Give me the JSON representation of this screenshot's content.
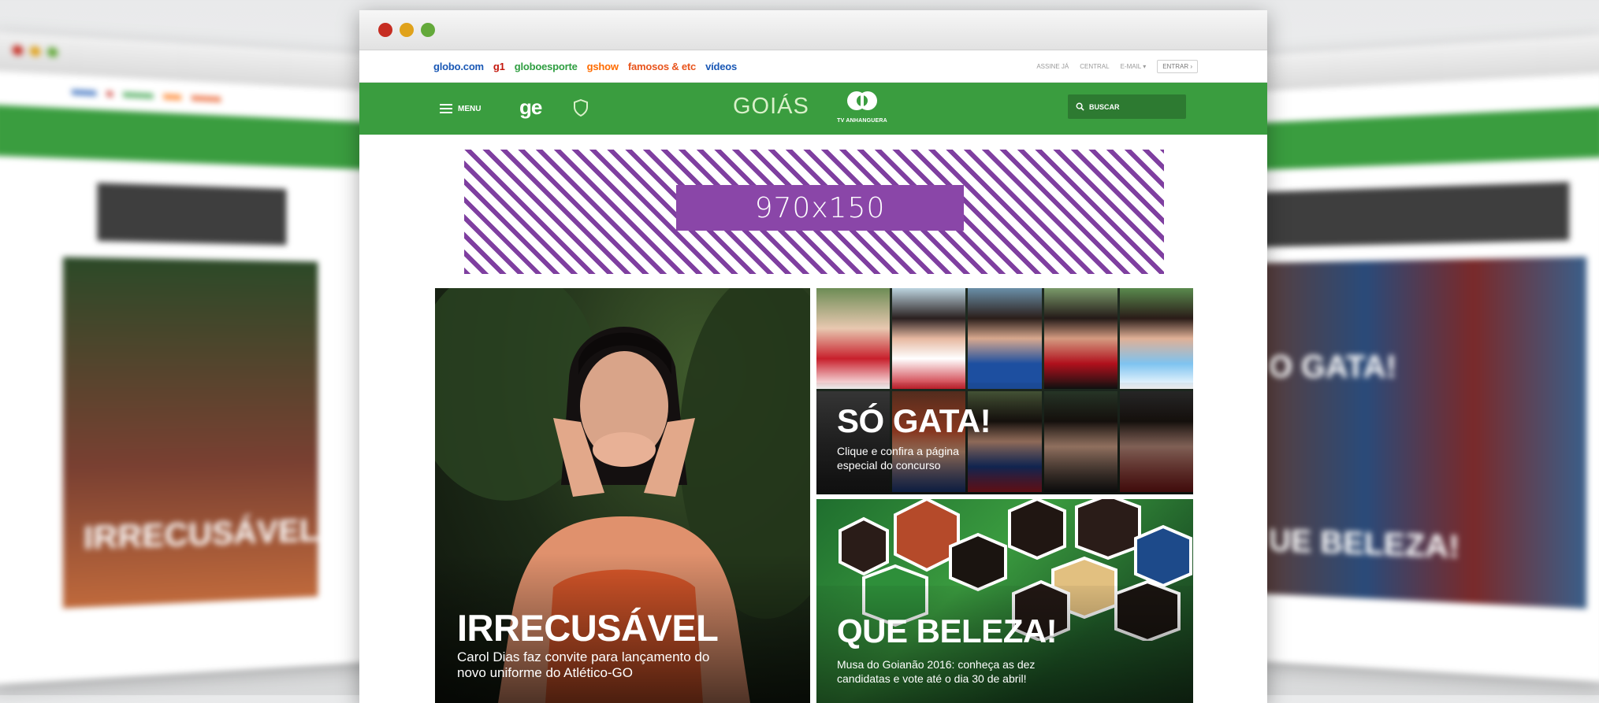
{
  "globo_links": [
    {
      "label": "globo.com",
      "color": "#1a58b5"
    },
    {
      "label": "g1",
      "color": "#c4170c"
    },
    {
      "label": "globoesporte",
      "color": "#2f9e41"
    },
    {
      "label": "gshow",
      "color": "#ff6c00"
    },
    {
      "label": "famosos & etc",
      "color": "#e8541c"
    },
    {
      "label": "vídeos",
      "color": "#1a58b5"
    }
  ],
  "utility_links": {
    "assine": "ASSINE JÁ",
    "central": "CENTRAL",
    "email": "E-MAIL",
    "entrar": "ENTRAR"
  },
  "nav": {
    "menu_label": "MENU",
    "ge_logo": "ge",
    "region": "GOIÁS",
    "tv_name": "TV ANHANGUERA",
    "search_label": "BUSCAR",
    "accent_color": "#3a9d3f"
  },
  "ad": {
    "label": "970x150"
  },
  "main_story": {
    "title": "IRRECUSÁVEL",
    "subtitle": "Carol Dias faz convite para lançamento do novo uniforme do Atlético-GO"
  },
  "promos": [
    {
      "title": "SÓ GATA!",
      "subtitle": "Clique e confira a página especial do concurso"
    },
    {
      "title": "QUE BELEZA!",
      "subtitle": "Musa do Goianão 2016: conheça as dez candidatas e vote até o dia 30 de abril!"
    }
  ],
  "side_windows": {
    "left_title": "IRRECUSÁVEL",
    "right_title_1": "O GATA!",
    "right_title_2": "UE BELEZA!"
  }
}
